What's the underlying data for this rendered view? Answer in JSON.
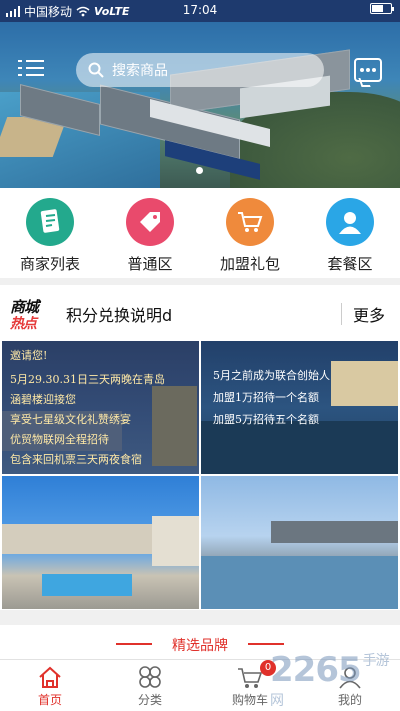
{
  "status_bar": {
    "carrier": "中国移动",
    "network": "VoLTE",
    "time": "17:04"
  },
  "header": {
    "search_placeholder": "搜索商品"
  },
  "categories": [
    {
      "label": "商家列表",
      "color": "#23a98d",
      "icon": "document-list-icon"
    },
    {
      "label": "普通区",
      "color": "#e94a6c",
      "icon": "price-tag-icon"
    },
    {
      "label": "加盟礼包",
      "color": "#ef8a3c",
      "icon": "shopping-cart-icon"
    },
    {
      "label": "套餐区",
      "color": "#2aa6e6",
      "icon": "user-icon"
    }
  ],
  "hot": {
    "logo_line1": "商城",
    "logo_line2": "热点",
    "text": "积分兑换说明d",
    "more": "更多"
  },
  "promos": [
    {
      "lines": [
        "邀请您!",
        "5月29.30.31日三天两晚在青岛",
        "涵碧楼迎接您",
        "享受七星级文化礼赞绣宴",
        "优贸物联网全程招待",
        "包含来回机票三天两夜食宿"
      ]
    },
    {
      "lines": [
        "5月之前成为联合创始人",
        "加盟1万招待一个名额",
        "加盟5万招待五个名额"
      ]
    },
    {
      "lines": []
    },
    {
      "lines": []
    }
  ],
  "brand_section": {
    "title": "精选品牌"
  },
  "tabbar": {
    "items": [
      {
        "label": "首页",
        "active": true,
        "icon": "home-icon"
      },
      {
        "label": "分类",
        "active": false,
        "icon": "category-icon"
      },
      {
        "label": "购物车",
        "active": false,
        "icon": "cart-icon",
        "badge": "0"
      },
      {
        "label": "我的",
        "active": false,
        "icon": "profile-icon"
      }
    ]
  },
  "watermark": {
    "brand": "2265",
    "sub": "手游网"
  },
  "colors": {
    "accent": "#e0312b",
    "status_bar": "#1e3a6e"
  }
}
